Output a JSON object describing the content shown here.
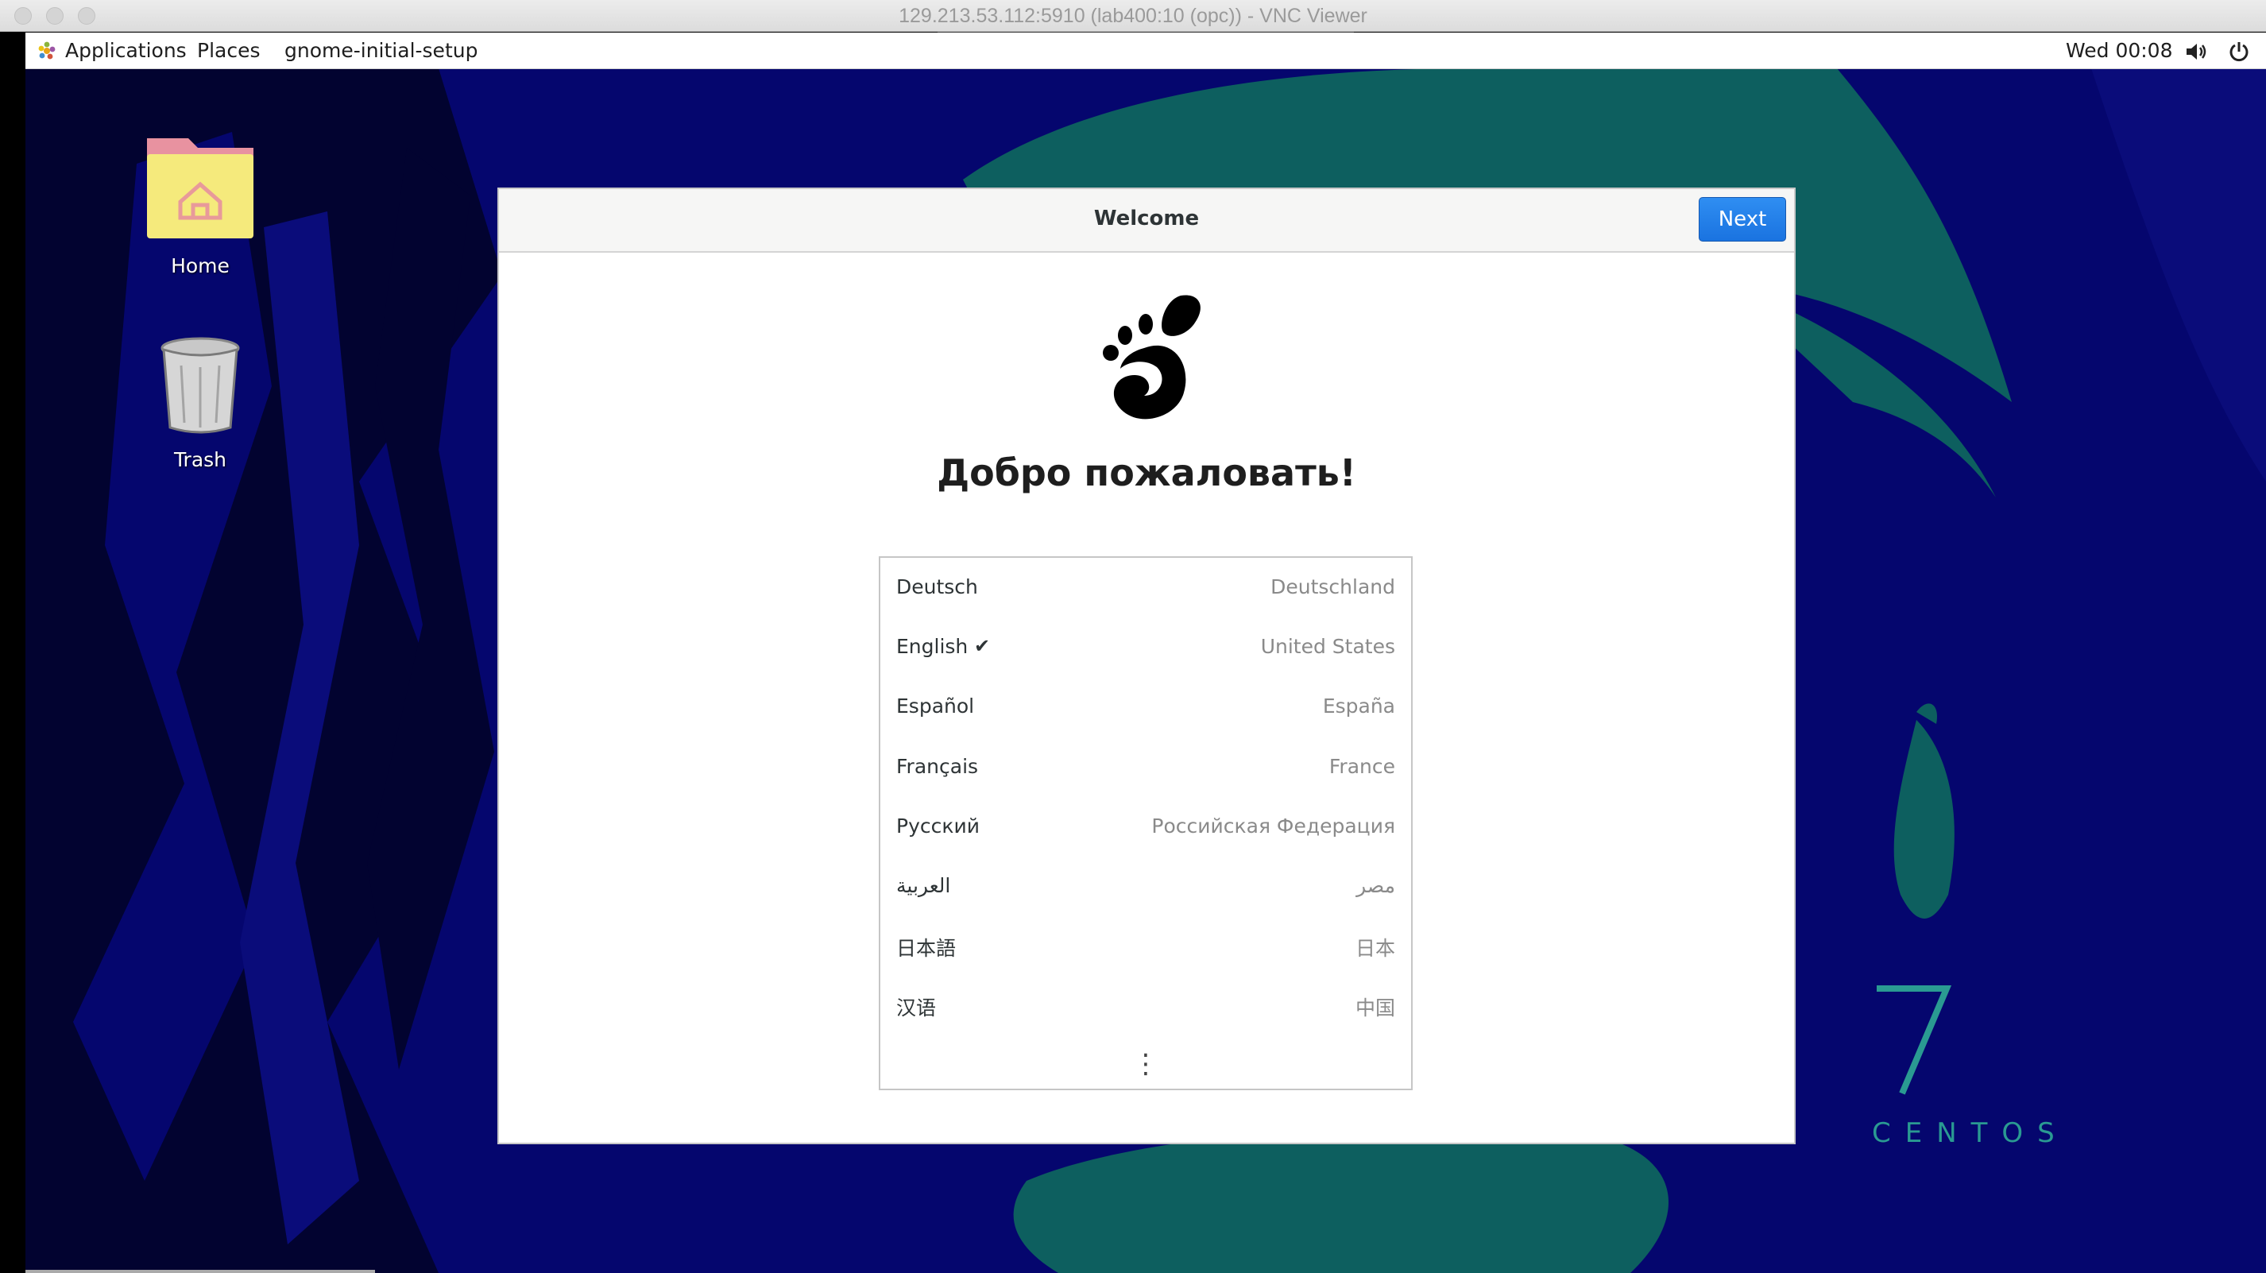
{
  "vnc_window": {
    "title": "129.213.53.112:5910 (lab400:10 (opc)) - VNC Viewer"
  },
  "topbar": {
    "applications": "Applications",
    "places": "Places",
    "active_app": "gnome-initial-setup",
    "clock": "Wed 00:08",
    "icons": [
      "volume-icon",
      "power-icon"
    ]
  },
  "desktop": {
    "icons": [
      {
        "label": "Home",
        "icon": "home-folder-icon"
      },
      {
        "label": "Trash",
        "icon": "trash-icon"
      }
    ],
    "branding": {
      "number": "7",
      "text": "CENTOS"
    }
  },
  "dialog": {
    "title": "Welcome",
    "next_label": "Next",
    "heading": "Добро пожаловать!",
    "languages": [
      {
        "name": "Deutsch",
        "region": "Deutschland",
        "selected": false
      },
      {
        "name": "English",
        "region": "United States",
        "selected": true
      },
      {
        "name": "Español",
        "region": "España",
        "selected": false
      },
      {
        "name": "Français",
        "region": "France",
        "selected": false
      },
      {
        "name": "Русский",
        "region": "Российская Федерация",
        "selected": false
      },
      {
        "name": "العربية",
        "region": "مصر",
        "selected": false
      },
      {
        "name": "日本語",
        "region": "日本",
        "selected": false
      },
      {
        "name": "汉语",
        "region": "中国",
        "selected": false
      }
    ],
    "more_label": "⋮"
  },
  "colors": {
    "desktop_bg": "#05066e",
    "teal": "#0d5f5f",
    "accent": "#1a73e0"
  }
}
